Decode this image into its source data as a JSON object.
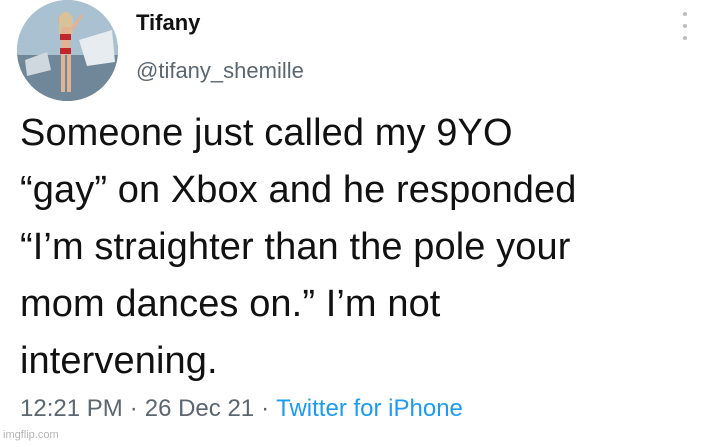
{
  "author": {
    "display_name": "Tifany",
    "handle": "@tifany_shemille",
    "avatar_icon": "profile-photo"
  },
  "tweet": {
    "text": "Someone just called my 9YO\n“gay” on Xbox and he responded\n“I’m straighter than the pole your\nmom dances on.” I’m not\nintervening.",
    "time": "12:21 PM",
    "date": "26 Dec 21",
    "separator": "·",
    "source": "Twitter for iPhone"
  },
  "menu": {
    "icon": "more-vertical-icon"
  },
  "watermark": "imgflip.com",
  "colors": {
    "text": "#111111",
    "secondary": "#5b6670",
    "link": "#1d9bf0",
    "background": "#ffffff"
  }
}
